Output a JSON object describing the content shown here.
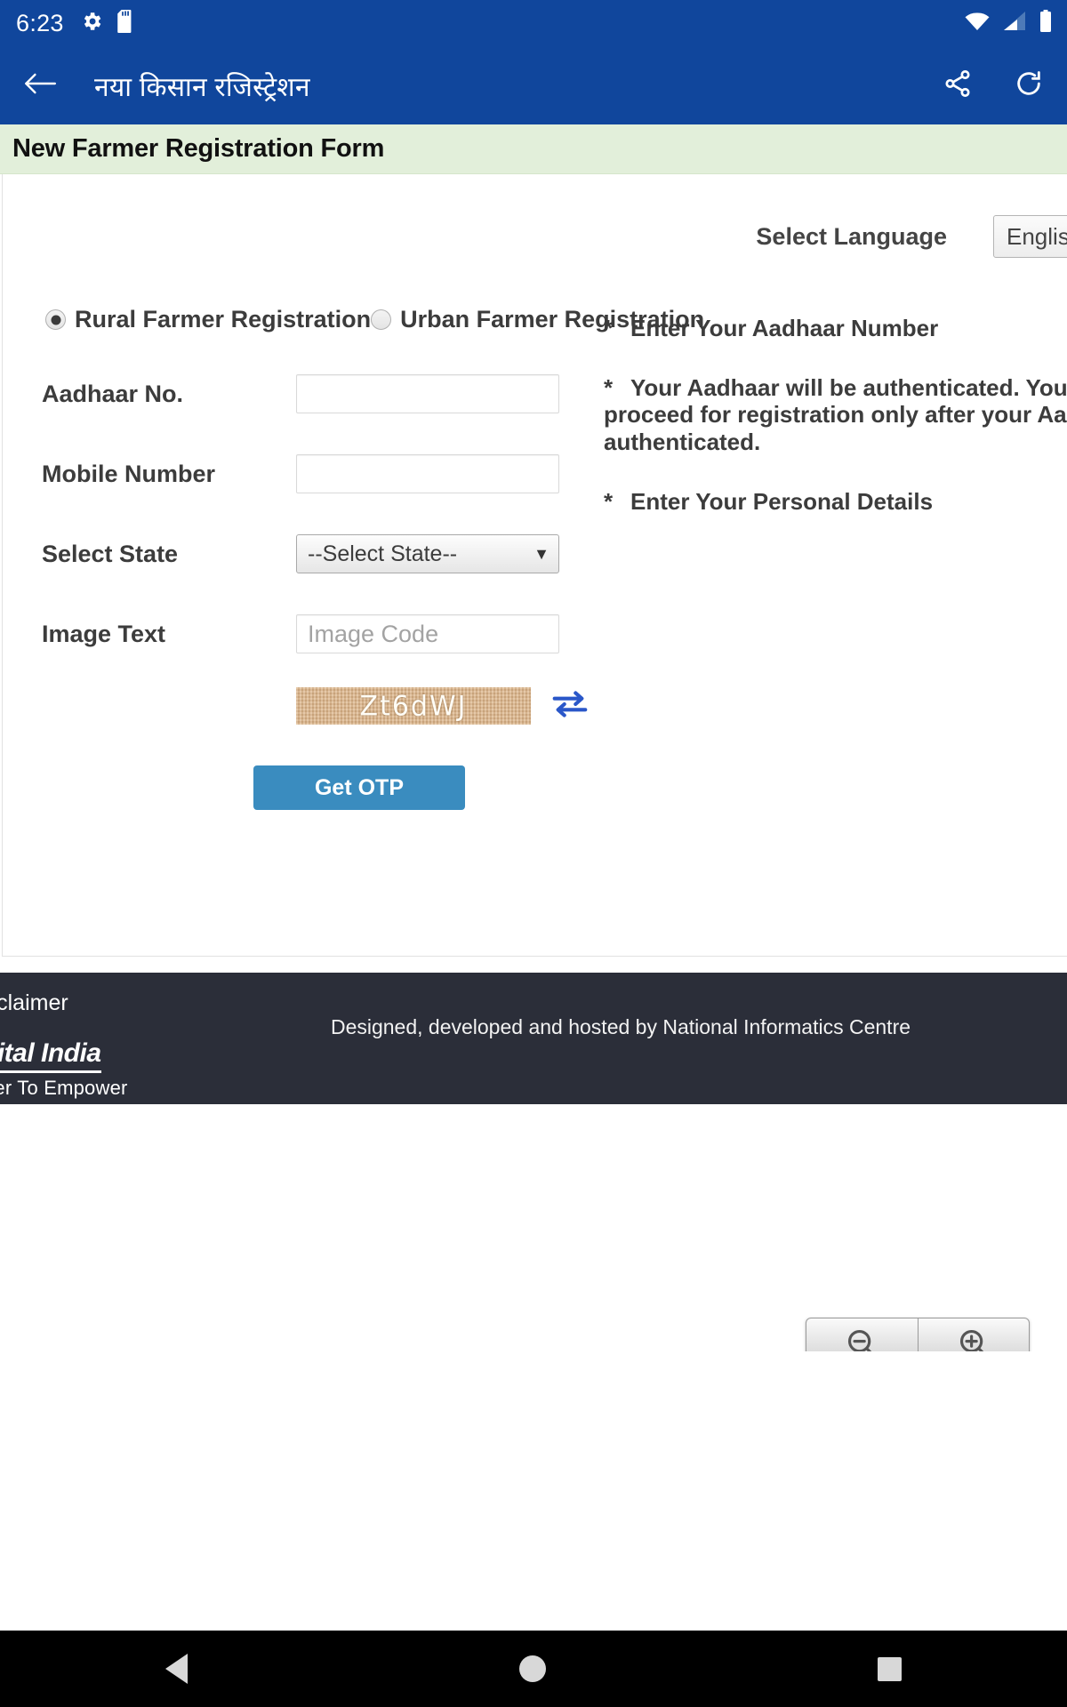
{
  "status_bar": {
    "time": "6:23",
    "icons_left": [
      "gear-icon",
      "sd-card-icon"
    ],
    "icons_right": [
      "wifi-icon",
      "cellular-signal-icon",
      "battery-icon"
    ]
  },
  "app_bar": {
    "back_label": "back-arrow",
    "title": "नया किसान रजिस्ट्रेशन",
    "actions": [
      "share-icon",
      "refresh-icon"
    ]
  },
  "page": {
    "heading": "New Farmer Registration Form",
    "language": {
      "label": "Select Language",
      "selected": "English"
    },
    "registration_type": {
      "options": [
        {
          "label": "Rural Farmer Registration",
          "selected": true
        },
        {
          "label": "Urban Farmer Registration",
          "selected": false
        }
      ]
    },
    "fields": [
      {
        "label": "Aadhaar No.",
        "type": "text",
        "value": "",
        "placeholder": ""
      },
      {
        "label": "Mobile Number",
        "type": "text",
        "value": "",
        "placeholder": ""
      },
      {
        "label": "Select State",
        "type": "select",
        "value": "--Select State--"
      },
      {
        "label": "Image Text",
        "type": "text",
        "value": "",
        "placeholder": "Image Code"
      }
    ],
    "captcha": {
      "text": "Zt6dWJ",
      "refresh_icon": "refresh-captcha-icon",
      "background_color": "#dbb285"
    },
    "submit_button": "Get OTP",
    "notes": [
      "Enter Your Aadhaar Number",
      "Your Aadhaar will be authenticated. You will be able to proceed for registration only after your Aadhaar is authenticated.",
      "Enter Your Personal Details"
    ],
    "note_bullet": "*"
  },
  "footer": {
    "disclaimer": "Disclaimer",
    "credit": "Designed, developed and hosted by National Informatics Centre",
    "logo_name": "Digital India",
    "logo_tagline": "Power To Empower"
  },
  "zoom_controls": {
    "zoom_out": "zoom-out-icon",
    "zoom_in": "zoom-in-icon"
  },
  "nav_bar": {
    "back": "nav-back-icon",
    "home": "nav-home-icon",
    "recents": "nav-recents-icon"
  },
  "colors": {
    "brand_blue": "#10469c",
    "header_green": "#e2efda",
    "button_blue": "#3a8cbf",
    "footer_dark": "#2b2e39"
  }
}
